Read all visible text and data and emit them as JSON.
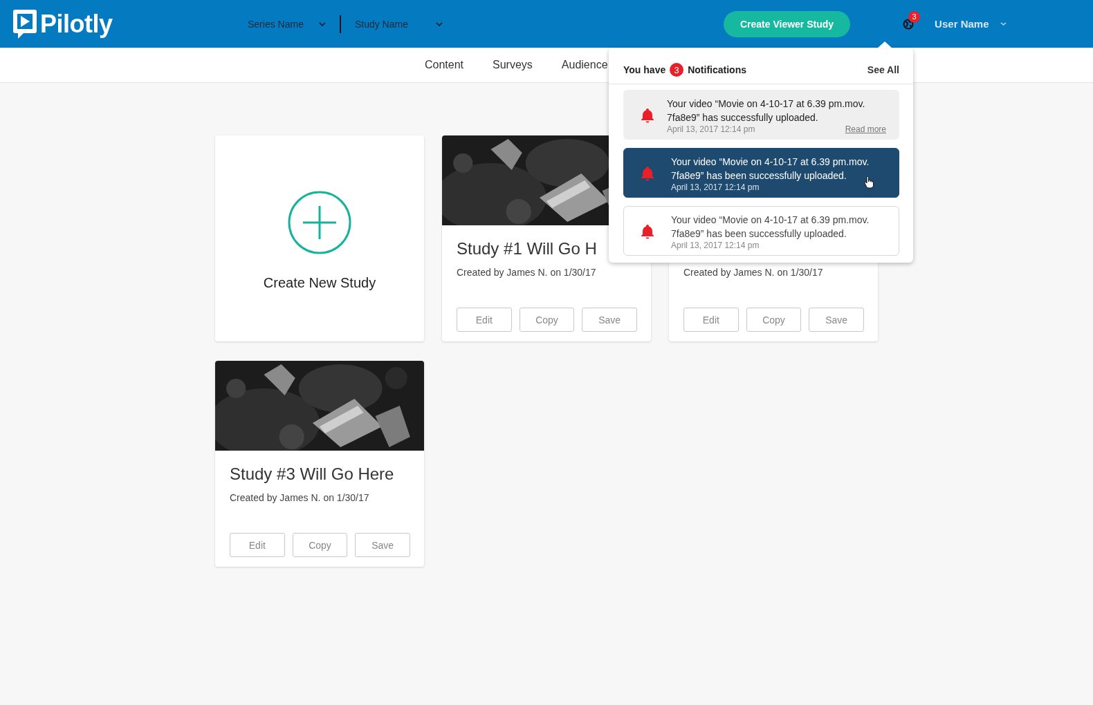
{
  "header": {
    "logo": "Pilotly",
    "selectors": [
      {
        "label": "Series Name"
      },
      {
        "label": "Study Name"
      }
    ],
    "create_button": "Create Viewer Study",
    "notification_count": "3",
    "user": "User Name"
  },
  "tabs": [
    {
      "label": "Content"
    },
    {
      "label": "Surveys"
    },
    {
      "label": "Audience"
    }
  ],
  "cards": [
    {
      "kind": "create",
      "label": "Create New Study"
    },
    {
      "kind": "study",
      "thumbnail": {
        "kind": "picture"
      },
      "title": "Study #1 Will Go H",
      "created": "Created by James N. on 1/30/17",
      "buttons": [
        "Edit",
        "Copy",
        "Save"
      ]
    },
    {
      "kind": "study",
      "created": "Created by James N. on 1/30/17",
      "buttons": [
        "Edit",
        "Copy",
        "Save"
      ]
    },
    {
      "kind": "study",
      "thumbnail": {
        "kind": "picture"
      },
      "title": "Study #3 Will Go Here",
      "created": "Created by James N. on 1/30/17",
      "buttons": [
        "Edit",
        "Copy",
        "Save"
      ]
    }
  ],
  "notifications": {
    "prefix": "You have",
    "count": "3",
    "suffix": "Notifications",
    "see_all": "See All",
    "items": [
      {
        "kind": "read",
        "text": "Your video “Movie on 4-10-17 at 6.39 pm.mov. 7fa8e9” has successfully uploaded.",
        "time": "April 13, 2017 12:14 pm",
        "link": "Read more",
        "selected": false
      },
      {
        "kind": "unread",
        "text": "Your video “Movie on 4-10-17 at 6.39 pm.mov. 7fa8e9” has been successfully uploaded.",
        "time": "April 13, 2017 12:14 pm",
        "selected": true
      },
      {
        "kind": "unread",
        "text": "Your video “Movie on 4-10-17 at 6.39 pm.mov. 7fa8e9” has been successfully uploaded.",
        "time": "April 13, 2017 12:14 pm",
        "selected": false
      }
    ]
  }
}
